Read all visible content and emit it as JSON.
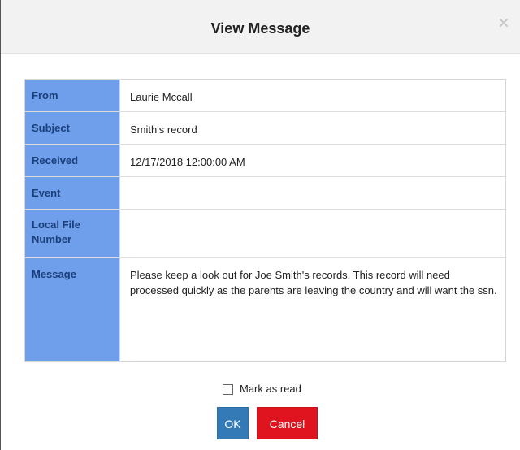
{
  "dialog": {
    "title": "View Message",
    "close_icon": "close-icon"
  },
  "message": {
    "rows": [
      {
        "label": "From",
        "value": "Laurie Mccall"
      },
      {
        "label": "Subject",
        "value": "Smith's record"
      },
      {
        "label": "Received",
        "value": "12/17/2018 12:00:00 AM"
      },
      {
        "label": "Event",
        "value": ""
      },
      {
        "label": "Local File Number",
        "value": ""
      },
      {
        "label": "Message",
        "value": "Please keep a look out for Joe Smith's records.  This record will need processed quickly as the parents are leaving the country and will want the ssn."
      }
    ]
  },
  "footer": {
    "mark_as_read_label": "Mark as read",
    "mark_as_read_checked": false,
    "ok_label": "OK",
    "cancel_label": "Cancel"
  },
  "colors": {
    "header_bg": "#f2f2f2",
    "label_bg": "#6f9eea",
    "label_text": "#1a3f7a",
    "ok_bg": "#337ab7",
    "cancel_bg": "#e0141e"
  }
}
